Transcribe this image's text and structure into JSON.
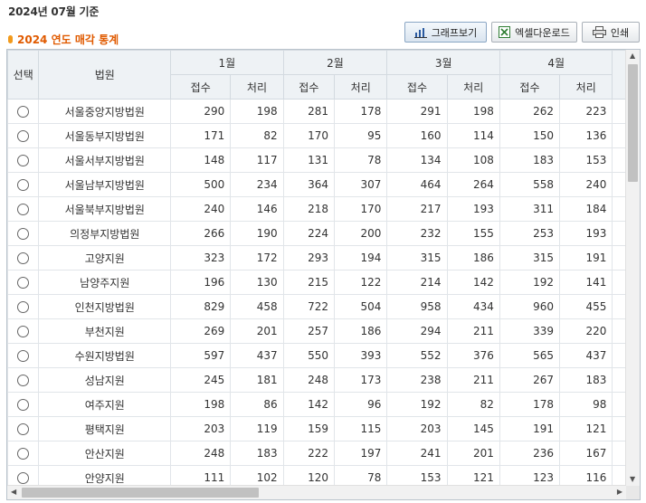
{
  "caption": "2024년 07월 기준",
  "section_title": "2024 연도 매각 통계",
  "buttons": {
    "graph": "그래프보기",
    "excel": "엑셀다운로드",
    "print": "인쇄"
  },
  "headers": {
    "select": "선택",
    "court": "법원",
    "months": [
      "1월",
      "2월",
      "3월",
      "4월"
    ],
    "receipt": "접수",
    "processed": "처리"
  },
  "rows": [
    {
      "court": "서울중앙지방법원",
      "values": [
        290,
        198,
        281,
        178,
        291,
        198,
        262,
        223
      ]
    },
    {
      "court": "서울동부지방법원",
      "values": [
        171,
        82,
        170,
        95,
        160,
        114,
        150,
        136
      ]
    },
    {
      "court": "서울서부지방법원",
      "values": [
        148,
        117,
        131,
        78,
        134,
        108,
        183,
        153
      ]
    },
    {
      "court": "서울남부지방법원",
      "values": [
        500,
        234,
        364,
        307,
        464,
        264,
        558,
        240
      ]
    },
    {
      "court": "서울북부지방법원",
      "values": [
        240,
        146,
        218,
        170,
        217,
        193,
        311,
        184
      ]
    },
    {
      "court": "의정부지방법원",
      "values": [
        266,
        190,
        224,
        200,
        232,
        155,
        253,
        193
      ]
    },
    {
      "court": "고양지원",
      "values": [
        323,
        172,
        293,
        194,
        315,
        186,
        315,
        191
      ]
    },
    {
      "court": "남양주지원",
      "values": [
        196,
        130,
        215,
        122,
        214,
        142,
        192,
        141
      ]
    },
    {
      "court": "인천지방법원",
      "values": [
        829,
        458,
        722,
        504,
        958,
        434,
        960,
        455
      ]
    },
    {
      "court": "부천지원",
      "values": [
        269,
        201,
        257,
        186,
        294,
        211,
        339,
        220
      ]
    },
    {
      "court": "수원지방법원",
      "values": [
        597,
        437,
        550,
        393,
        552,
        376,
        565,
        437
      ]
    },
    {
      "court": "성남지원",
      "values": [
        245,
        181,
        248,
        173,
        238,
        211,
        267,
        183
      ]
    },
    {
      "court": "여주지원",
      "values": [
        198,
        86,
        142,
        96,
        192,
        82,
        178,
        98
      ]
    },
    {
      "court": "평택지원",
      "values": [
        203,
        119,
        159,
        115,
        203,
        145,
        191,
        121
      ]
    },
    {
      "court": "안산지원",
      "values": [
        248,
        183,
        222,
        197,
        241,
        201,
        236,
        167
      ]
    },
    {
      "court": "안양지원",
      "values": [
        111,
        102,
        120,
        78,
        153,
        121,
        123,
        116
      ]
    }
  ]
}
